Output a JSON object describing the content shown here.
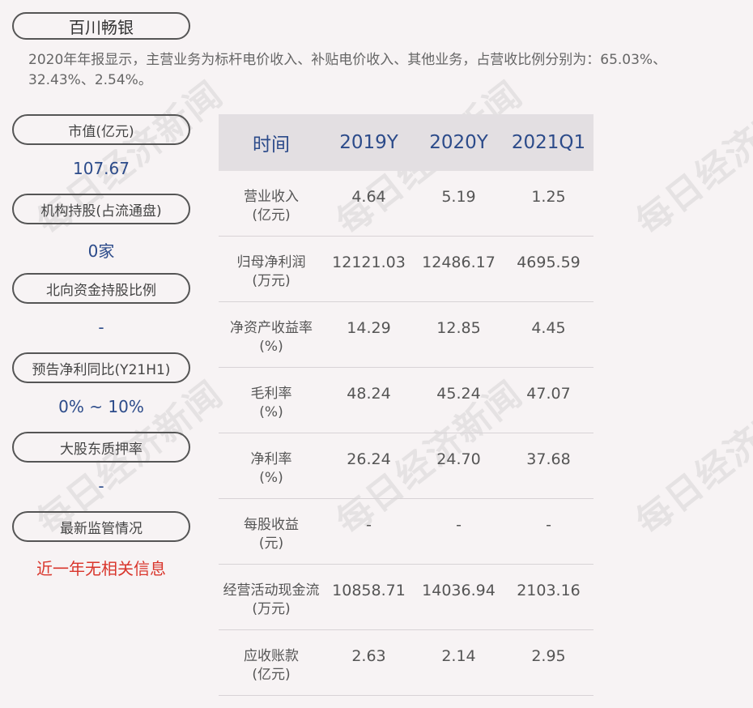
{
  "company": "百川畅银",
  "description": "2020年年报显示，主营业务为标杆电价收入、补贴电价收入、其他业务，占营收比例分别为：65.03%、32.43%、2.54%。",
  "watermark": "每日经济新闻",
  "metrics": [
    {
      "label": "市值(亿元)",
      "value": "107.67"
    },
    {
      "label": "机构持股(占流通盘)",
      "value": "0家"
    },
    {
      "label": "北向资金持股比例",
      "value": "-"
    },
    {
      "label": "预告净利同比(Y21H1)",
      "value": "0% ~ 10%"
    },
    {
      "label": "大股东质押率",
      "value": "-"
    },
    {
      "label": "最新监管情况",
      "value": "近一年无相关信息"
    }
  ],
  "table": {
    "headers": [
      "时间",
      "2019Y",
      "2020Y",
      "2021Q1"
    ],
    "rows": [
      {
        "name": "营业收入",
        "unit": "(亿元)",
        "values": [
          "4.64",
          "5.19",
          "1.25"
        ]
      },
      {
        "name": "归母净利润",
        "unit": "(万元)",
        "values": [
          "12121.03",
          "12486.17",
          "4695.59"
        ]
      },
      {
        "name": "净资产收益率",
        "unit": "(%)",
        "values": [
          "14.29",
          "12.85",
          "4.45"
        ]
      },
      {
        "name": "毛利率",
        "unit": "(%)",
        "values": [
          "48.24",
          "45.24",
          "47.07"
        ]
      },
      {
        "name": "净利率",
        "unit": "(%)",
        "values": [
          "26.24",
          "24.70",
          "37.68"
        ]
      },
      {
        "name": "每股收益",
        "unit": "(元)",
        "values": [
          "-",
          "-",
          "-"
        ]
      },
      {
        "name": "经营活动现金流",
        "unit": "(万元)",
        "values": [
          "10858.71",
          "14036.94",
          "2103.16"
        ]
      },
      {
        "name": "应收账款",
        "unit": "(亿元)",
        "values": [
          "2.63",
          "2.14",
          "2.95"
        ]
      }
    ]
  },
  "colors": {
    "accent_blue": "#2c4b8a",
    "alert_red": "#d9352b",
    "header_bg": "#e3dfe2"
  }
}
